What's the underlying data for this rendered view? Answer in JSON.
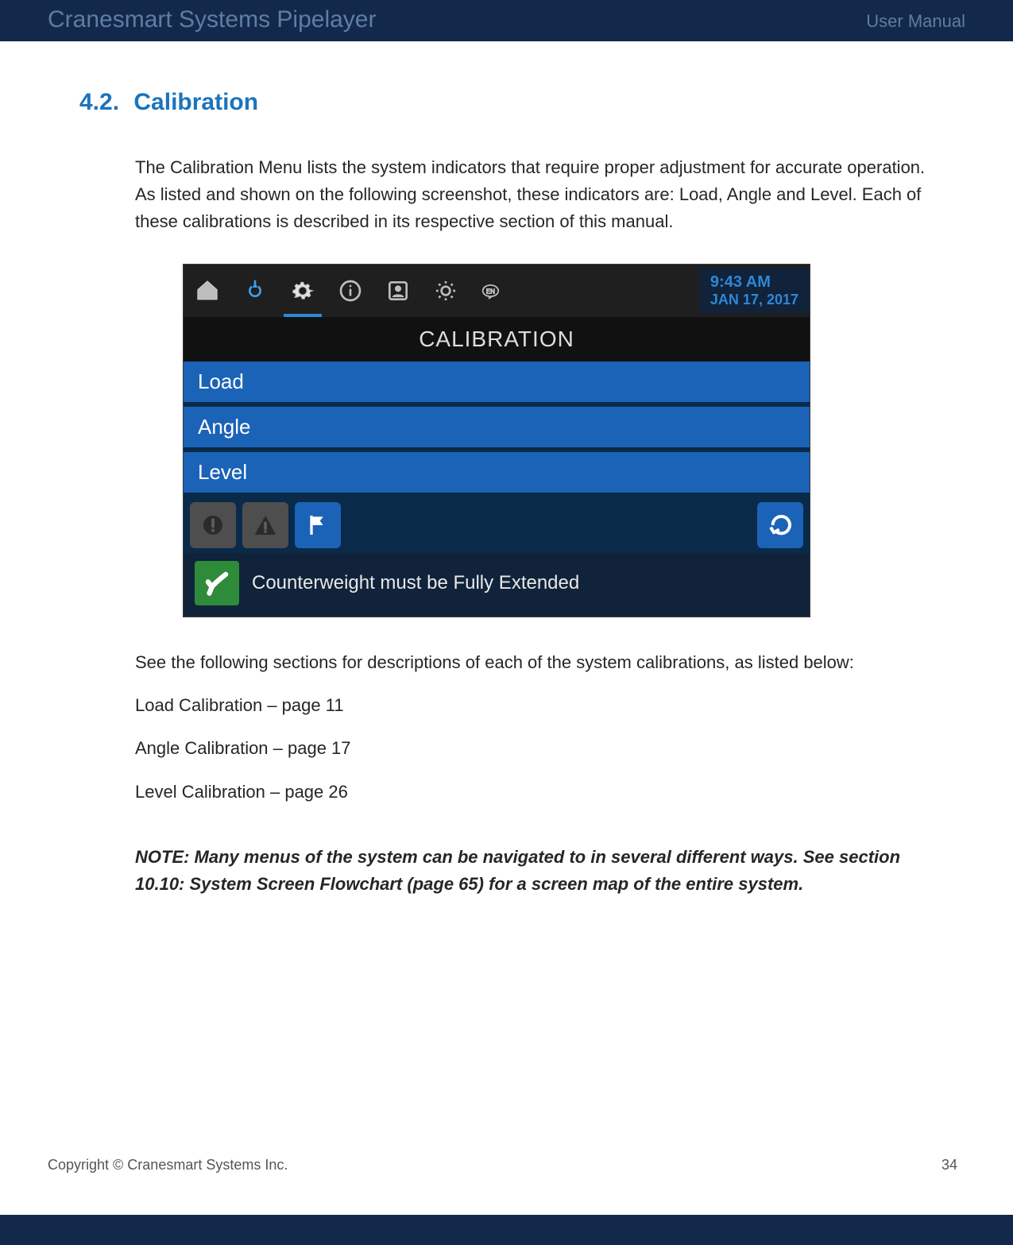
{
  "header": {
    "title": "Cranesmart Systems Pipelayer",
    "right": "User Manual"
  },
  "section": {
    "number": "4.2.",
    "title": "Calibration"
  },
  "paragraphs": {
    "intro": "The Calibration Menu lists the system indicators that require proper adjustment for accurate operation.  As listed and shown on the following screenshot, these indicators are: Load, Angle and Level.  Each of these calibrations is described in its respective section of this manual.",
    "after": "See the following sections for descriptions of each of the system calibrations, as listed below:",
    "list1": "Load Calibration – page 11",
    "list2": "Angle Calibration – page 17",
    "list3": "Level Calibration – page 26",
    "note": "NOTE:  Many menus of the system can be navigated to in several different ways.  See section 10.10: System Screen Flowchart (page 65) for a screen map of the entire system."
  },
  "device": {
    "clock": {
      "time": "9:43 AM",
      "date": "JAN 17, 2017"
    },
    "screen_title": "CALIBRATION",
    "items": [
      "Load",
      "Angle",
      "Level"
    ],
    "status_text": "Counterweight must be Fully Extended",
    "lang": "EN"
  },
  "footer": {
    "copyright": "Copyright © Cranesmart Systems Inc.",
    "page": "34"
  }
}
